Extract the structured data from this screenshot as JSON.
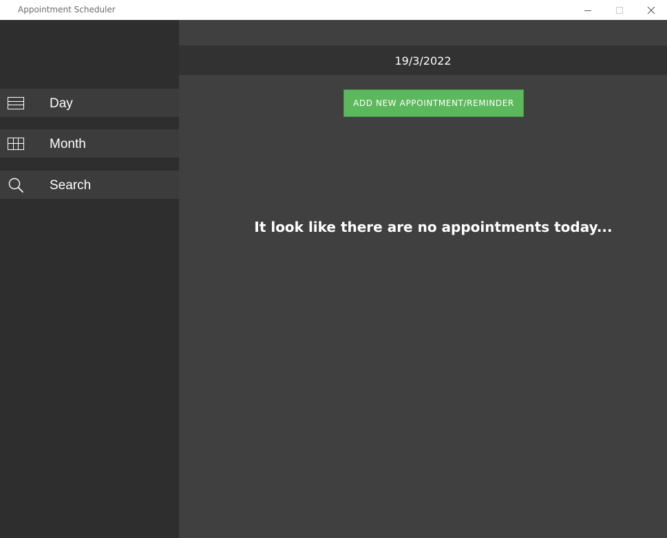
{
  "window": {
    "title": "Appointment Scheduler"
  },
  "sidebar": {
    "items": [
      {
        "label": "Day",
        "icon": "list-icon"
      },
      {
        "label": "Month",
        "icon": "calendar-grid-icon"
      },
      {
        "label": "Search",
        "icon": "search-icon"
      }
    ]
  },
  "main": {
    "date": "19/3/2022",
    "add_button_label": "ADD NEW APPOINTMENT/REMINDER",
    "empty_message": "It look like there are no appointments today..."
  },
  "colors": {
    "sidebar_bg": "#2e2e2e",
    "nav_item_bg": "#3c3c3c",
    "main_bg": "#404040",
    "date_bar_bg": "#323232",
    "accent_green": "#5cb85c",
    "text": "#ffffff"
  }
}
